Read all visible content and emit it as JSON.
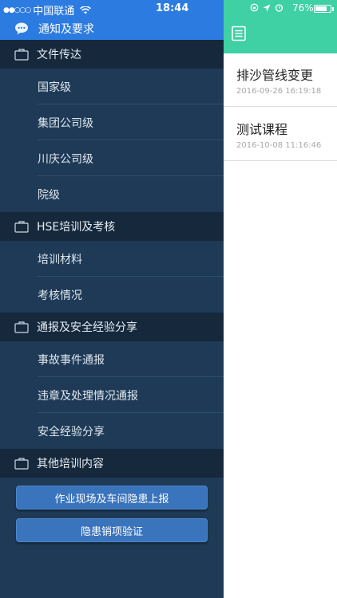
{
  "status": {
    "signal_dots": "●●○○○",
    "carrier": "中国联通",
    "time": "18:44",
    "battery_text": "76%",
    "battery_level": 0.76
  },
  "drawer": {
    "header_title": "通知及要求",
    "sections": [
      {
        "title": "文件传达",
        "items": [
          "国家级",
          "集团公司级",
          "川庆公司级",
          "院级"
        ]
      },
      {
        "title": "HSE培训及考核",
        "items": [
          "培训材料",
          "考核情况"
        ]
      },
      {
        "title": "通报及安全经验分享",
        "items": [
          "事故事件通报",
          "违章及处理情况通报",
          "安全经验分享"
        ]
      },
      {
        "title": "其他培训内容",
        "items": []
      }
    ],
    "buttons": [
      "作业现场及车间隐患上报",
      "隐患销项验证"
    ]
  },
  "list": [
    {
      "title": "排沙管线变更",
      "date": "2016-09-26 16:19:18"
    },
    {
      "title": "测试课程",
      "date": "2016-10-08 11:16:46"
    }
  ],
  "colors": {
    "drawer_bg": "#1e3a56",
    "section_bg": "#15283c",
    "header_blue": "#2c7be0",
    "header_green": "#3fd0a4",
    "button_blue": "#3a74bd"
  }
}
